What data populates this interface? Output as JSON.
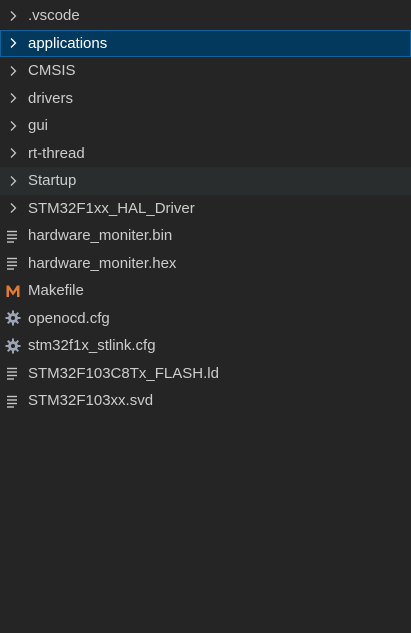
{
  "explorer": {
    "items": [
      {
        "label": ".vscode",
        "kind": "folder",
        "icon": "chevron-right-icon"
      },
      {
        "label": "applications",
        "kind": "folder",
        "icon": "chevron-right-icon",
        "selected": true
      },
      {
        "label": "CMSIS",
        "kind": "folder",
        "icon": "chevron-right-icon"
      },
      {
        "label": "drivers",
        "kind": "folder",
        "icon": "chevron-right-icon"
      },
      {
        "label": "gui",
        "kind": "folder",
        "icon": "chevron-right-icon"
      },
      {
        "label": "rt-thread",
        "kind": "folder",
        "icon": "chevron-right-icon"
      },
      {
        "label": "Startup",
        "kind": "folder",
        "icon": "chevron-right-icon",
        "hover": true
      },
      {
        "label": "STM32F1xx_HAL_Driver",
        "kind": "folder",
        "icon": "chevron-right-icon"
      },
      {
        "label": "hardware_moniter.bin",
        "kind": "file",
        "icon": "text-file-icon"
      },
      {
        "label": "hardware_moniter.hex",
        "kind": "file",
        "icon": "text-file-icon"
      },
      {
        "label": "Makefile",
        "kind": "file",
        "icon": "makefile-icon"
      },
      {
        "label": "openocd.cfg",
        "kind": "file",
        "icon": "gear-icon"
      },
      {
        "label": "stm32f1x_stlink.cfg",
        "kind": "file",
        "icon": "gear-icon"
      },
      {
        "label": "STM32F103C8Tx_FLASH.ld",
        "kind": "file",
        "icon": "text-file-icon"
      },
      {
        "label": "STM32F103xx.svd",
        "kind": "file",
        "icon": "text-file-icon"
      }
    ]
  },
  "colors": {
    "background": "#252526",
    "selected_background": "#04395e",
    "selected_border": "#0e639c",
    "hover_background": "#2a2d2e",
    "makefile_icon": "#e37933",
    "icon_gray": "#c5c5c5"
  }
}
